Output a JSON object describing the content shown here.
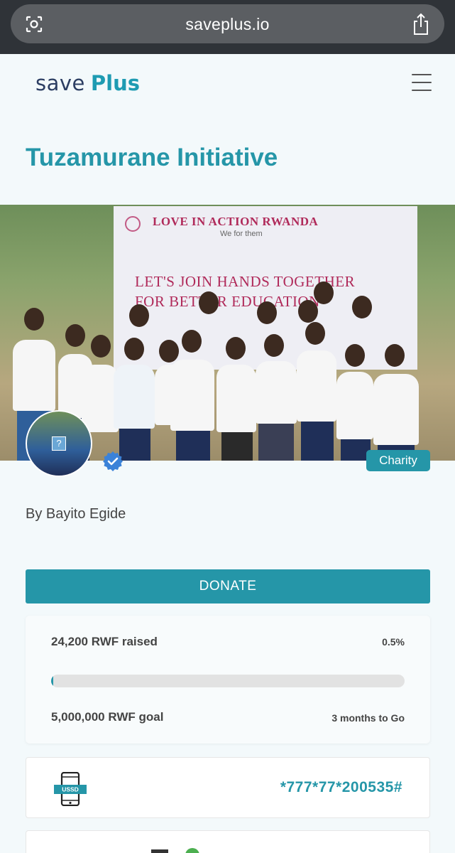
{
  "browser": {
    "url": "saveplus.io"
  },
  "header": {
    "logo_save": "save",
    "logo_plus": "Plus"
  },
  "campaign": {
    "title": "Tuzamurane Initiative",
    "banner_org": "LOVE IN ACTION RWANDA",
    "banner_subtitle": "We for them",
    "banner_line1": "LET'S JOIN HANDS TOGETHER",
    "banner_line2": "FOR BETTER EDUCATION",
    "category": "Charity",
    "author": "By Bayito Egide",
    "donate_label": "DONATE"
  },
  "stats": {
    "raised": "24,200 RWF raised",
    "percent": "0.5%",
    "progress_fraction": 0.005,
    "goal": "5,000,000 RWF goal",
    "time_left": "3 months to Go"
  },
  "ussd": {
    "icon_label": "USSD",
    "code": "*777*77*200535#"
  },
  "icons": {
    "camera": "camera-scan-icon",
    "share": "share-icon",
    "menu": "hamburger-menu-icon",
    "verified": "verified-badge-icon",
    "phone": "ussd-phone-icon"
  },
  "colors": {
    "accent": "#2596a8",
    "logo_dark": "#2c3e63",
    "banner_text": "#b02a5a"
  }
}
